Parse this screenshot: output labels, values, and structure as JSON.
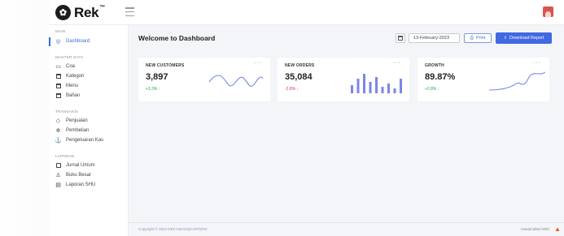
{
  "brand": {
    "name": "Rek",
    "tm": "™"
  },
  "sidebar": {
    "sections": [
      {
        "label": "MAIN"
      },
      {
        "label": "MASTER DATA"
      },
      {
        "label": "TRANSAKSI"
      },
      {
        "label": "LAPORAN"
      }
    ],
    "items": [
      {
        "label": "Dashboard"
      },
      {
        "label": "Coa"
      },
      {
        "label": "Kategori"
      },
      {
        "label": "Menu"
      },
      {
        "label": "Bahan"
      },
      {
        "label": "Penjualan"
      },
      {
        "label": "Pembelian"
      },
      {
        "label": "Pengeluaran Kas"
      },
      {
        "label": "Jurnal Umum"
      },
      {
        "label": "Buku Besar"
      },
      {
        "label": "Laporan SHU"
      }
    ]
  },
  "header": {
    "title": "Welcome to Dashboard",
    "date": "13-February-2023",
    "print_label": "Print",
    "download_label": "Download Report"
  },
  "cards": [
    {
      "label": "NEW CUSTOMERS",
      "value": "3,897",
      "change": "+3.3% ↑"
    },
    {
      "label": "NEW ORDERS",
      "value": "35,084",
      "change": "-2.8% ↓"
    },
    {
      "label": "GROWTH",
      "value": "89.87%",
      "change": "+2.8% ↑"
    }
  ],
  "footer": {
    "copyright": "Copyright © 2023 REK-HEADQUARTERS",
    "credit": "Handcrafted With"
  },
  "colors": {
    "accent": "#4169e1",
    "up": "#28a745",
    "down": "#dc3545",
    "chart": "#7a86e8"
  }
}
